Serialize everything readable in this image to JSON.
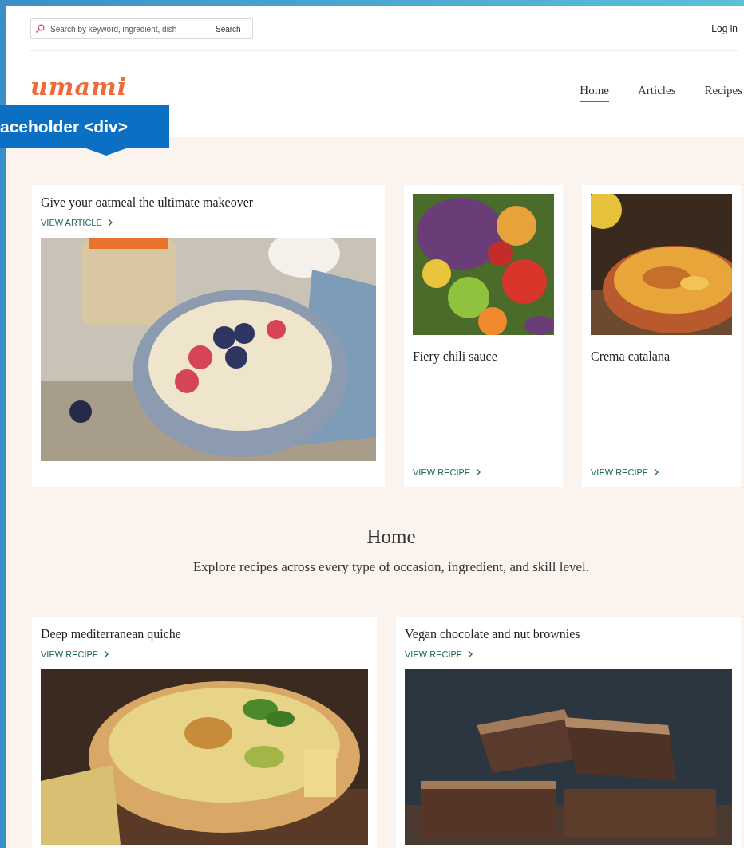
{
  "search": {
    "placeholder": "Search by keyword, ingredient, dish",
    "button": "Search"
  },
  "login": "Log in",
  "logo": "umami",
  "nav": [
    {
      "label": "Home",
      "selected": true
    },
    {
      "label": "Articles",
      "selected": false
    },
    {
      "label": "Recipes",
      "selected": false
    }
  ],
  "tooltip": "aceholder <div>",
  "featured": [
    {
      "title": "Give your oatmeal the ultimate makeover",
      "link": "VIEW ARTICLE"
    },
    {
      "title": "Fiery chili sauce",
      "link": "VIEW RECIPE"
    },
    {
      "title": "Crema catalana",
      "link": "VIEW RECIPE"
    }
  ],
  "intro": {
    "heading": "Home",
    "text": "Explore recipes across every type of occasion, ingredient, and skill level."
  },
  "recipes": [
    {
      "title": "Deep mediterranean quiche",
      "link": "VIEW RECIPE"
    },
    {
      "title": "Vegan chocolate and nut brownies",
      "link": "VIEW RECIPE"
    }
  ]
}
